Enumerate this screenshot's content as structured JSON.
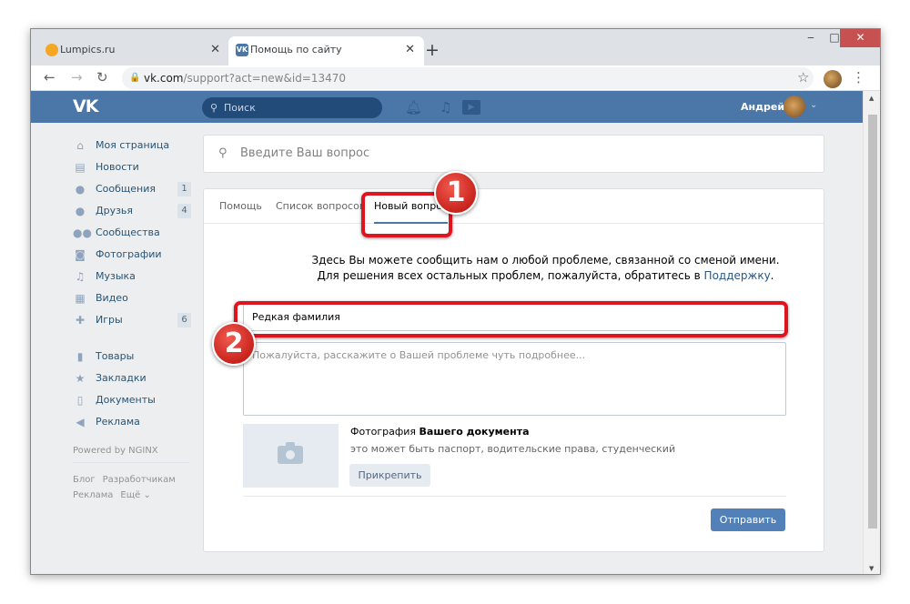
{
  "browser": {
    "tabs": [
      {
        "title": "Lumpics.ru",
        "active": false
      },
      {
        "title": "Помощь по сайту",
        "active": true
      }
    ],
    "favicon_vk": "VK",
    "url_domain": "vk.com",
    "url_path": "/support?act=new&id=13470"
  },
  "vk": {
    "logo": "VK",
    "search_placeholder": "Поиск",
    "user_name": "Андрей"
  },
  "sidebar": {
    "items": [
      {
        "label": "Моя страница",
        "icon": "home-icon",
        "count": ""
      },
      {
        "label": "Новости",
        "icon": "news-icon",
        "count": ""
      },
      {
        "label": "Сообщения",
        "icon": "messages-icon",
        "count": "1"
      },
      {
        "label": "Друзья",
        "icon": "friends-icon",
        "count": "4"
      },
      {
        "label": "Сообщества",
        "icon": "groups-icon",
        "count": ""
      },
      {
        "label": "Фотографии",
        "icon": "camera-icon",
        "count": ""
      },
      {
        "label": "Музыка",
        "icon": "music-icon",
        "count": ""
      },
      {
        "label": "Видео",
        "icon": "video-icon",
        "count": ""
      },
      {
        "label": "Игры",
        "icon": "games-icon",
        "count": "6"
      }
    ],
    "items2": [
      {
        "label": "Товары",
        "icon": "market-icon"
      },
      {
        "label": "Закладки",
        "icon": "bookmarks-icon"
      },
      {
        "label": "Документы",
        "icon": "documents-icon"
      },
      {
        "label": "Реклама",
        "icon": "ads-icon"
      }
    ],
    "powered": "Powered by NGINX",
    "footer_links": [
      "Блог",
      "Разработчикам",
      "Реклама",
      "Ещё ⌄"
    ]
  },
  "support": {
    "question_placeholder": "Введите Ваш вопрос",
    "tabs": [
      "Помощь",
      "Список вопросов",
      "Новый вопрос"
    ],
    "info_line1": "Здесь Вы можете сообщить нам о любой проблеме, связанной со сменой имени.",
    "info_line2": "Для решения всех остальных проблем, пожалуйста, обратитесь в",
    "info_link": "Поддержку",
    "subject_value": "Редкая фамилия",
    "description_placeholder": "Пожалуйста, расскажите о Вашей проблеме чуть подробнее...",
    "doc_title_plain": "Фотография",
    "doc_title_bold": "Вашего документа",
    "doc_subtitle": "это может быть паспорт, водительские права, студенческий",
    "attach_label": "Прикрепить",
    "send_label": "Отправить"
  },
  "annotations": {
    "marker1": "1",
    "marker2": "2",
    "color": "#e0141e"
  },
  "colors": {
    "vk_blue": "#4a76a8",
    "button_blue": "#5181b8"
  }
}
